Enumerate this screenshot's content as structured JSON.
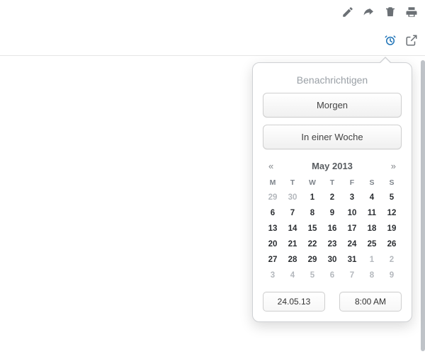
{
  "toolbar": {
    "edit": "edit",
    "share": "share",
    "trash": "trash",
    "print": "print"
  },
  "subtoolbar": {
    "reminder": "reminder",
    "open_external": "open-external"
  },
  "popover": {
    "title": "Benachrichtigen",
    "buttons": {
      "tomorrow": "Morgen",
      "next_week": "In einer Woche"
    },
    "calendar": {
      "nav_prev": "«",
      "nav_next": "»",
      "month_label": "May 2013",
      "dow": [
        "M",
        "T",
        "W",
        "T",
        "F",
        "S",
        "S"
      ],
      "weeks": [
        [
          {
            "d": "29",
            "other": true
          },
          {
            "d": "30",
            "other": true
          },
          {
            "d": "1"
          },
          {
            "d": "2"
          },
          {
            "d": "3"
          },
          {
            "d": "4"
          },
          {
            "d": "5"
          }
        ],
        [
          {
            "d": "6"
          },
          {
            "d": "7"
          },
          {
            "d": "8"
          },
          {
            "d": "9"
          },
          {
            "d": "10"
          },
          {
            "d": "11"
          },
          {
            "d": "12"
          }
        ],
        [
          {
            "d": "13"
          },
          {
            "d": "14"
          },
          {
            "d": "15"
          },
          {
            "d": "16"
          },
          {
            "d": "17"
          },
          {
            "d": "18"
          },
          {
            "d": "19"
          }
        ],
        [
          {
            "d": "20"
          },
          {
            "d": "21"
          },
          {
            "d": "22"
          },
          {
            "d": "23"
          },
          {
            "d": "24"
          },
          {
            "d": "25"
          },
          {
            "d": "26"
          }
        ],
        [
          {
            "d": "27"
          },
          {
            "d": "28"
          },
          {
            "d": "29"
          },
          {
            "d": "30"
          },
          {
            "d": "31"
          },
          {
            "d": "1",
            "other": true
          },
          {
            "d": "2",
            "other": true
          }
        ],
        [
          {
            "d": "3",
            "other": true
          },
          {
            "d": "4",
            "other": true
          },
          {
            "d": "5",
            "other": true
          },
          {
            "d": "6",
            "other": true
          },
          {
            "d": "7",
            "other": true
          },
          {
            "d": "8",
            "other": true
          },
          {
            "d": "9",
            "other": true
          }
        ]
      ]
    },
    "fields": {
      "date": "24.05.13",
      "time": "8:00 AM"
    }
  },
  "colors": {
    "icon_default": "#6b7075",
    "icon_active": "#1e73b7"
  }
}
